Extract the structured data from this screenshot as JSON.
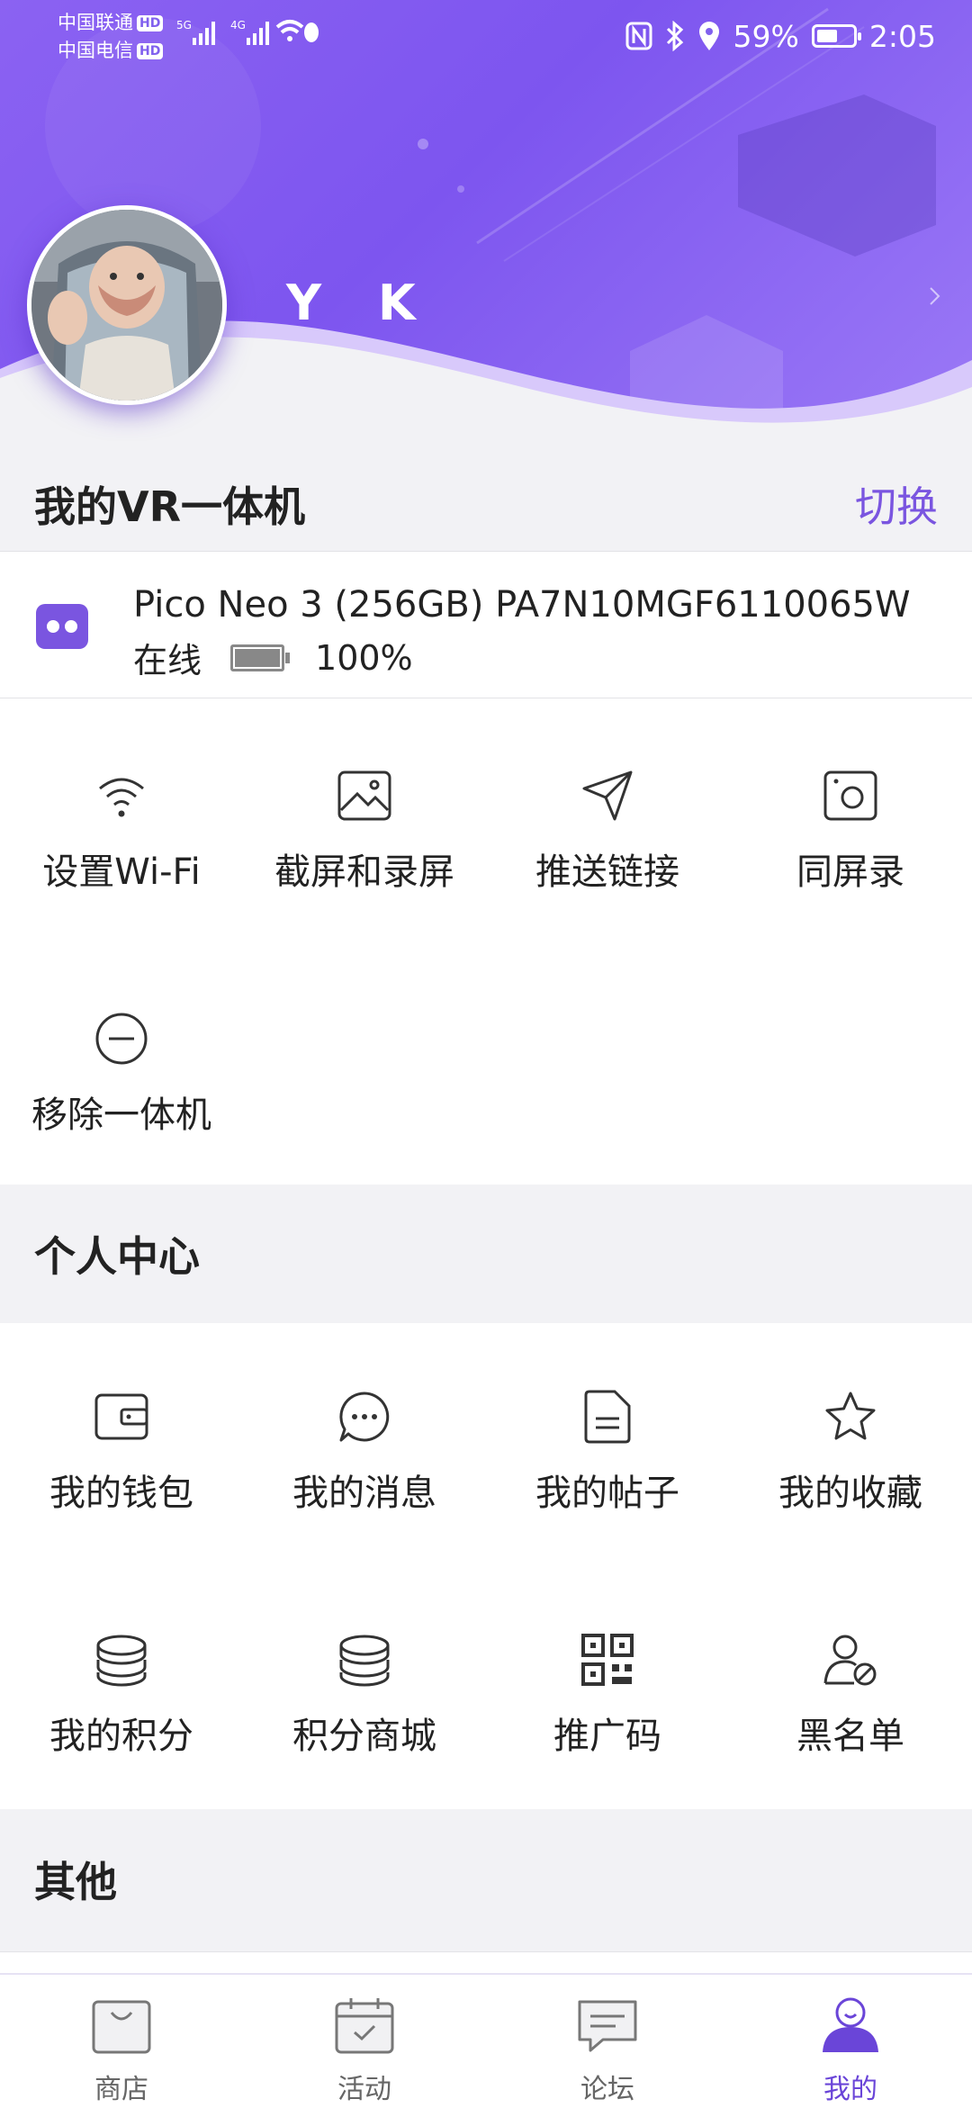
{
  "status_bar": {
    "carrier1": "中国联通",
    "carrier2": "中国电信",
    "hd": "HD",
    "net1": "5G",
    "net2": "4G",
    "battery_percent": "59%",
    "battery_level": 0.59,
    "time": "2:05"
  },
  "profile": {
    "username": "Y K",
    "avatar_icon": "baby-photo-avatar"
  },
  "vr_section": {
    "title": "我的VR一体机",
    "switch_label": "切换"
  },
  "device": {
    "name": "Pico Neo 3 (256GB) PA7N10MGF6110065W",
    "status": "在线",
    "battery": "100%",
    "battery_level": 1.0
  },
  "device_actions": [
    {
      "label": "设置Wi-Fi",
      "icon": "wifi-icon"
    },
    {
      "label": "截屏和录屏",
      "icon": "image-icon"
    },
    {
      "label": "推送链接",
      "icon": "send-icon"
    },
    {
      "label": "同屏录",
      "icon": "camera-icon"
    },
    {
      "label": "移除一体机",
      "icon": "remove-icon"
    }
  ],
  "personal_section": {
    "title": "个人中心",
    "items": [
      {
        "label": "我的钱包",
        "icon": "wallet-icon"
      },
      {
        "label": "我的消息",
        "icon": "message-icon"
      },
      {
        "label": "我的帖子",
        "icon": "document-icon"
      },
      {
        "label": "我的收藏",
        "icon": "star-icon"
      },
      {
        "label": "我的积分",
        "icon": "coins-icon"
      },
      {
        "label": "积分商城",
        "icon": "coins-store-icon"
      },
      {
        "label": "推广码",
        "icon": "qr-code-icon"
      },
      {
        "label": "黑名单",
        "icon": "blocked-user-icon"
      }
    ]
  },
  "other_section": {
    "title": "其他"
  },
  "bottom_nav": [
    {
      "label": "商店",
      "icon": "shop-bag-icon",
      "active": false
    },
    {
      "label": "活动",
      "icon": "calendar-icon",
      "active": false
    },
    {
      "label": "论坛",
      "icon": "forum-icon",
      "active": false
    },
    {
      "label": "我的",
      "icon": "profile-icon",
      "active": true
    }
  ],
  "colors": {
    "brand": "#7d55ef",
    "accent_text": "#7a55e0",
    "active_nav": "#6a45d8"
  }
}
